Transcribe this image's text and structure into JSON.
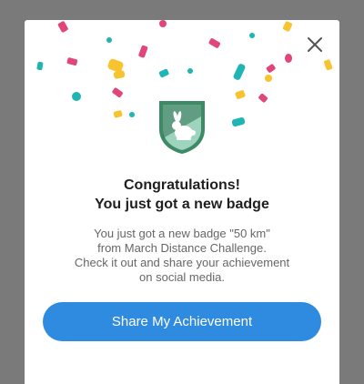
{
  "dialog": {
    "close_icon": "close-icon",
    "badge_icon": "rabbit-badge-icon",
    "title_line1": "Congratulations!",
    "title_line2": "You just got a new badge",
    "message_line1": "You just got a new badge \"50 km\"",
    "message_line2": "from March Distance Challenge.",
    "message_line3": "Check it out and share your achievement",
    "message_line4": "on social media.",
    "share_button": "Share My Achievement"
  },
  "colors": {
    "backdrop": "#7a7a7a",
    "accent": "#2f8be0",
    "badge_green": "#3d8a66",
    "confetti_pink": "#e0457b",
    "confetti_yellow": "#f7c430",
    "confetti_teal": "#1fb5b5"
  }
}
